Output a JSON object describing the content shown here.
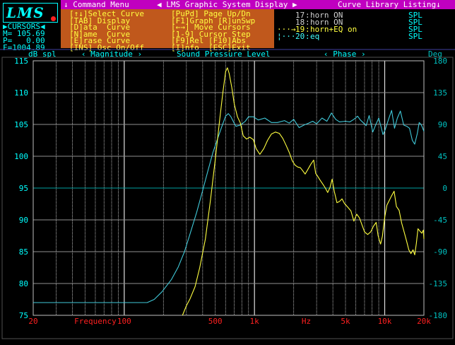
{
  "menubar": {
    "command_menu": "↓ Command Menu",
    "graphic_display": "◀ LMS Graphic System Display ▶",
    "curve_library": "Curve Library Listing↓"
  },
  "logo_text": "LMS",
  "cursors": {
    "label": "▶CURSORS◀",
    "m": "M= 105.69",
    "p": "P=   0.00",
    "f": "F=1004.89"
  },
  "menu": {
    "left": [
      "[↑↓]Select Curve",
      "[TAB] Display",
      "[D]ata  Curve",
      "[N]ame  Curve",
      "[E]rase Curve",
      "[INS] Osc On/Off"
    ],
    "right": [
      "[PuPd] Page Up/Dn",
      "[F1]Graph [R]unSwp",
      "[←→] Move Cursors",
      "[1-9] Cursor Step",
      "[F9]Rel [F10]Abs",
      "[I]nfo  [ESC]Exit"
    ]
  },
  "library": [
    {
      "prefix": "    ",
      "num": "17",
      "name": "horn ON",
      "type": "SPL",
      "color": "#d0d0d0"
    },
    {
      "prefix": "    ",
      "num": "18",
      "name": "horn ON",
      "type": "SPL",
      "color": "#d0d0d0"
    },
    {
      "prefix": "···→",
      "num": "19",
      "name": "horn+EQ on",
      "type": "SPL",
      "color": "#ffff40"
    },
    {
      "prefix": "¦···",
      "num": "20",
      "name": "eq",
      "type": "SPL",
      "color": "#40ffff"
    }
  ],
  "header": {
    "left_unit": "dB spl",
    "magnitude": "‹ Magnitude ›",
    "title": "Sound Pressure Level",
    "phase": "‹ Phase ›",
    "right_unit": "Deg"
  },
  "colors": {
    "grid": "#e0e0e0",
    "magnitude_curve": "#ffff40",
    "phase_curve": "#40c8d8",
    "left_axis": "#00ffff",
    "right_axis": "#00c0c0",
    "bottom_axis": "#ff2020"
  },
  "chart_data": {
    "type": "line",
    "title": "Sound Pressure Level",
    "xlabel": "Frequency",
    "x_scale": "log",
    "xlim": [
      20,
      20000
    ],
    "x_ticks": [
      {
        "value": 20,
        "label": "20"
      },
      {
        "value": 100,
        "label": "100"
      },
      {
        "value": 500,
        "label": "500"
      },
      {
        "value": 1000,
        "label": "1k"
      },
      {
        "value": 2500,
        "label": "Hz"
      },
      {
        "value": 5000,
        "label": "5k"
      },
      {
        "value": 10000,
        "label": "10k"
      },
      {
        "value": 20000,
        "label": "20k"
      }
    ],
    "x_label_text": "Frequency",
    "left_axis": {
      "label": "dB spl",
      "range": [
        75,
        115
      ],
      "ticks": [
        115,
        110,
        105,
        100,
        95,
        90,
        85,
        80,
        75
      ]
    },
    "right_axis": {
      "label": "Deg",
      "range": [
        -180,
        180
      ],
      "ticks": [
        180,
        135,
        90,
        45,
        0,
        -45,
        -90,
        -135,
        -180
      ]
    },
    "series": [
      {
        "id": "phase-curve",
        "axis": "left",
        "points": [
          [
            20,
            77.0
          ],
          [
            150,
            77.0
          ],
          [
            170,
            77.5
          ],
          [
            195,
            78.7
          ],
          [
            230,
            80.6
          ],
          [
            260,
            82.6
          ],
          [
            290,
            85.0
          ],
          [
            320,
            87.8
          ],
          [
            360,
            91.2
          ],
          [
            400,
            94.6
          ],
          [
            440,
            97.8
          ],
          [
            480,
            100.6
          ],
          [
            520,
            102.7
          ],
          [
            560,
            104.6
          ],
          [
            600,
            106.3
          ],
          [
            630,
            106.7
          ],
          [
            660,
            106.2
          ],
          [
            690,
            105.4
          ],
          [
            720,
            104.7
          ],
          [
            780,
            104.9
          ],
          [
            850,
            105.5
          ],
          [
            900,
            106.2
          ],
          [
            980,
            106.2
          ],
          [
            1070,
            105.7
          ],
          [
            1200,
            106.0
          ],
          [
            1350,
            105.3
          ],
          [
            1500,
            105.3
          ],
          [
            1700,
            105.6
          ],
          [
            1850,
            105.2
          ],
          [
            2000,
            105.8
          ],
          [
            2200,
            104.5
          ],
          [
            2400,
            104.9
          ],
          [
            2600,
            105.2
          ],
          [
            2800,
            105.5
          ],
          [
            3000,
            105.1
          ],
          [
            3300,
            106.0
          ],
          [
            3600,
            105.5
          ],
          [
            3900,
            106.8
          ],
          [
            4200,
            105.8
          ],
          [
            4500,
            105.4
          ],
          [
            5000,
            105.5
          ],
          [
            5400,
            105.4
          ],
          [
            5800,
            105.8
          ],
          [
            6200,
            106.3
          ],
          [
            6500,
            105.7
          ],
          [
            6900,
            105.2
          ],
          [
            7200,
            104.8
          ],
          [
            7600,
            106.4
          ],
          [
            8100,
            103.8
          ],
          [
            8600,
            105.1
          ],
          [
            9000,
            106.0
          ],
          [
            9700,
            103.4
          ],
          [
            10100,
            104.2
          ],
          [
            10700,
            105.8
          ],
          [
            11300,
            107.2
          ],
          [
            11900,
            104.4
          ],
          [
            12500,
            106.0
          ],
          [
            13200,
            107.1
          ],
          [
            14000,
            104.9
          ],
          [
            14800,
            104.7
          ],
          [
            15500,
            104.4
          ],
          [
            16300,
            102.5
          ],
          [
            17000,
            101.9
          ],
          [
            17800,
            103.6
          ],
          [
            18400,
            105.3
          ],
          [
            19000,
            105.0
          ],
          [
            19500,
            104.5
          ],
          [
            20000,
            103.9
          ]
        ]
      },
      {
        "id": "magnitude-curve",
        "axis": "left",
        "points": [
          [
            280,
            75.0
          ],
          [
            300,
            76.5
          ],
          [
            320,
            77.6
          ],
          [
            350,
            79.5
          ],
          [
            380,
            82.5
          ],
          [
            420,
            87.0
          ],
          [
            460,
            93.2
          ],
          [
            500,
            99.5
          ],
          [
            540,
            105.6
          ],
          [
            570,
            109.8
          ],
          [
            600,
            113.3
          ],
          [
            620,
            113.9
          ],
          [
            640,
            113.0
          ],
          [
            670,
            110.8
          ],
          [
            700,
            108.2
          ],
          [
            740,
            106.2
          ],
          [
            780,
            105.2
          ],
          [
            820,
            103.2
          ],
          [
            870,
            102.7
          ],
          [
            920,
            103.0
          ],
          [
            980,
            102.6
          ],
          [
            1030,
            101.2
          ],
          [
            1100,
            100.3
          ],
          [
            1180,
            101.2
          ],
          [
            1260,
            102.5
          ],
          [
            1350,
            103.5
          ],
          [
            1450,
            103.8
          ],
          [
            1550,
            103.6
          ],
          [
            1650,
            102.8
          ],
          [
            1750,
            101.7
          ],
          [
            1850,
            100.6
          ],
          [
            1950,
            99.3
          ],
          [
            2050,
            98.6
          ],
          [
            2150,
            98.3
          ],
          [
            2250,
            98.2
          ],
          [
            2350,
            97.7
          ],
          [
            2450,
            97.2
          ],
          [
            2550,
            97.8
          ],
          [
            2700,
            98.7
          ],
          [
            2850,
            99.4
          ],
          [
            2950,
            97.3
          ],
          [
            3050,
            96.9
          ],
          [
            3200,
            96.2
          ],
          [
            3350,
            95.6
          ],
          [
            3500,
            95.0
          ],
          [
            3650,
            94.3
          ],
          [
            3800,
            95.1
          ],
          [
            3950,
            96.4
          ],
          [
            4100,
            94.5
          ],
          [
            4300,
            92.7
          ],
          [
            4500,
            92.9
          ],
          [
            4700,
            93.3
          ],
          [
            4900,
            92.6
          ],
          [
            5200,
            92.0
          ],
          [
            5500,
            91.4
          ],
          [
            5800,
            89.8
          ],
          [
            6100,
            90.9
          ],
          [
            6400,
            90.3
          ],
          [
            6700,
            89.2
          ],
          [
            7000,
            88.1
          ],
          [
            7400,
            87.7
          ],
          [
            7800,
            88.1
          ],
          [
            8200,
            89.0
          ],
          [
            8600,
            89.6
          ],
          [
            8900,
            87.5
          ],
          [
            9100,
            86.8
          ],
          [
            9300,
            86.2
          ],
          [
            9600,
            87.4
          ],
          [
            10000,
            90.4
          ],
          [
            10400,
            92.3
          ],
          [
            10800,
            93.0
          ],
          [
            11300,
            93.8
          ],
          [
            11800,
            94.5
          ],
          [
            12300,
            92.1
          ],
          [
            12900,
            91.5
          ],
          [
            13500,
            89.5
          ],
          [
            14100,
            88.1
          ],
          [
            14700,
            86.7
          ],
          [
            15300,
            85.3
          ],
          [
            15900,
            84.7
          ],
          [
            16500,
            85.3
          ],
          [
            17000,
            84.5
          ],
          [
            17500,
            86.3
          ],
          [
            18000,
            88.6
          ],
          [
            18700,
            88.2
          ],
          [
            19300,
            87.9
          ],
          [
            19800,
            88.4
          ],
          [
            20000,
            87.0
          ]
        ]
      }
    ]
  }
}
